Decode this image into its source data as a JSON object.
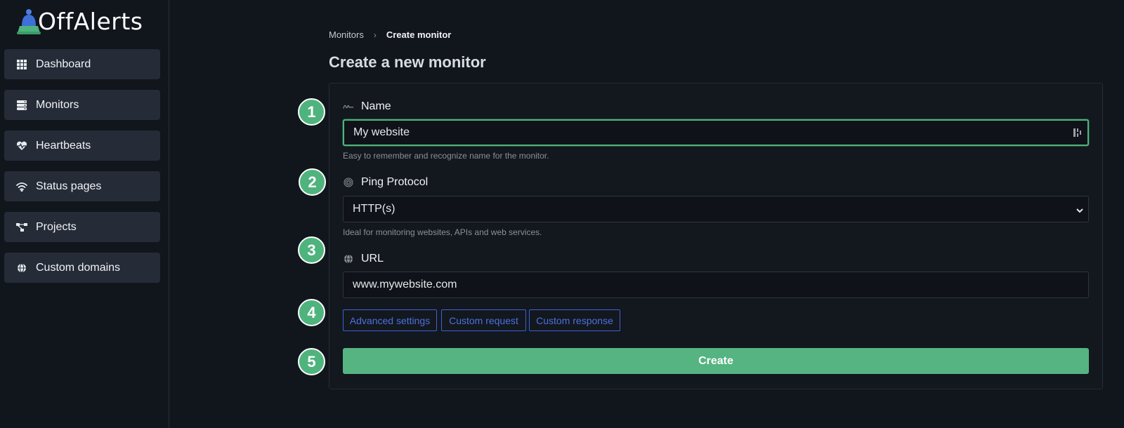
{
  "brand": {
    "name": "OffAlerts",
    "accent": "#4fb37d"
  },
  "sidebar": {
    "items": [
      {
        "label": "Dashboard",
        "icon": "grid-icon"
      },
      {
        "label": "Monitors",
        "icon": "server-icon"
      },
      {
        "label": "Heartbeats",
        "icon": "heartbeat-icon"
      },
      {
        "label": "Status pages",
        "icon": "wifi-icon"
      },
      {
        "label": "Projects",
        "icon": "project-tree-icon"
      },
      {
        "label": "Custom domains",
        "icon": "globe-icon"
      }
    ]
  },
  "breadcrumb": {
    "parent": "Monitors",
    "current": "Create monitor"
  },
  "page": {
    "title": "Create a new monitor"
  },
  "form": {
    "steps": [
      "1",
      "2",
      "3",
      "4",
      "5"
    ],
    "name": {
      "label": "Name",
      "value": "My website",
      "help": "Easy to remember and recognize name for the monitor."
    },
    "protocol": {
      "label": "Ping Protocol",
      "value": "HTTP(s)",
      "help": "Ideal for monitoring websites, APIs and web services."
    },
    "url": {
      "label": "URL",
      "value": "www.mywebsite.com"
    },
    "buttons": {
      "advanced": "Advanced settings",
      "custom_request": "Custom request",
      "custom_response": "Custom response",
      "create": "Create"
    }
  }
}
